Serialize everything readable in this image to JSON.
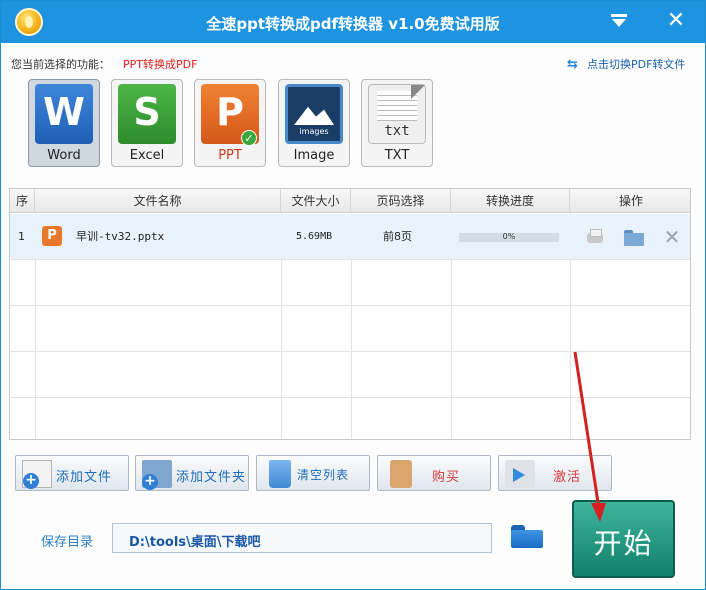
{
  "window": {
    "title": "全速ppt转换成pdf转换器 v1.0免费试用版",
    "close_glyph": "✕"
  },
  "function_row": {
    "label": "您当前选择的功能：",
    "value": "PPT转换成PDF",
    "switch_icon": "⇆",
    "switch_text": "点击切换PDF转文件"
  },
  "formats": [
    {
      "label": "Word",
      "icon": "word-icon",
      "letter": "W"
    },
    {
      "label": "Excel",
      "icon": "excel-icon",
      "letter": "S"
    },
    {
      "label": "PPT",
      "icon": "ppt-icon",
      "letter": "P",
      "checked": true
    },
    {
      "label": "Image",
      "icon": "image-icon",
      "caption": "images"
    },
    {
      "label": "TXT",
      "icon": "txt-icon",
      "caption": "txt"
    }
  ],
  "table": {
    "headers": [
      "序",
      "文件名称",
      "文件大小",
      "页码选择",
      "转换进度",
      "操作"
    ],
    "rows": [
      {
        "index": "1",
        "file_icon_letter": "P",
        "name": "早训-tv32.pptx",
        "size": "5.69MB",
        "pages": "前8页",
        "progress_text": "0%",
        "progress": 0
      }
    ],
    "delete_glyph": "✕"
  },
  "buttons": {
    "add_file": "添加文件",
    "add_folder": "添加文件夹",
    "clear_list": "清空列表",
    "buy": "购买",
    "activate": "激活",
    "plus_glyph": "+"
  },
  "save": {
    "label": "保存目录",
    "path": "D:\\tools\\桌面\\下载吧"
  },
  "start": {
    "label": "开始"
  },
  "colors": {
    "title_bar": "#1e93e0",
    "accent_red": "#e02020",
    "start_green": "#12806a",
    "arrow_red": "#d42020"
  }
}
